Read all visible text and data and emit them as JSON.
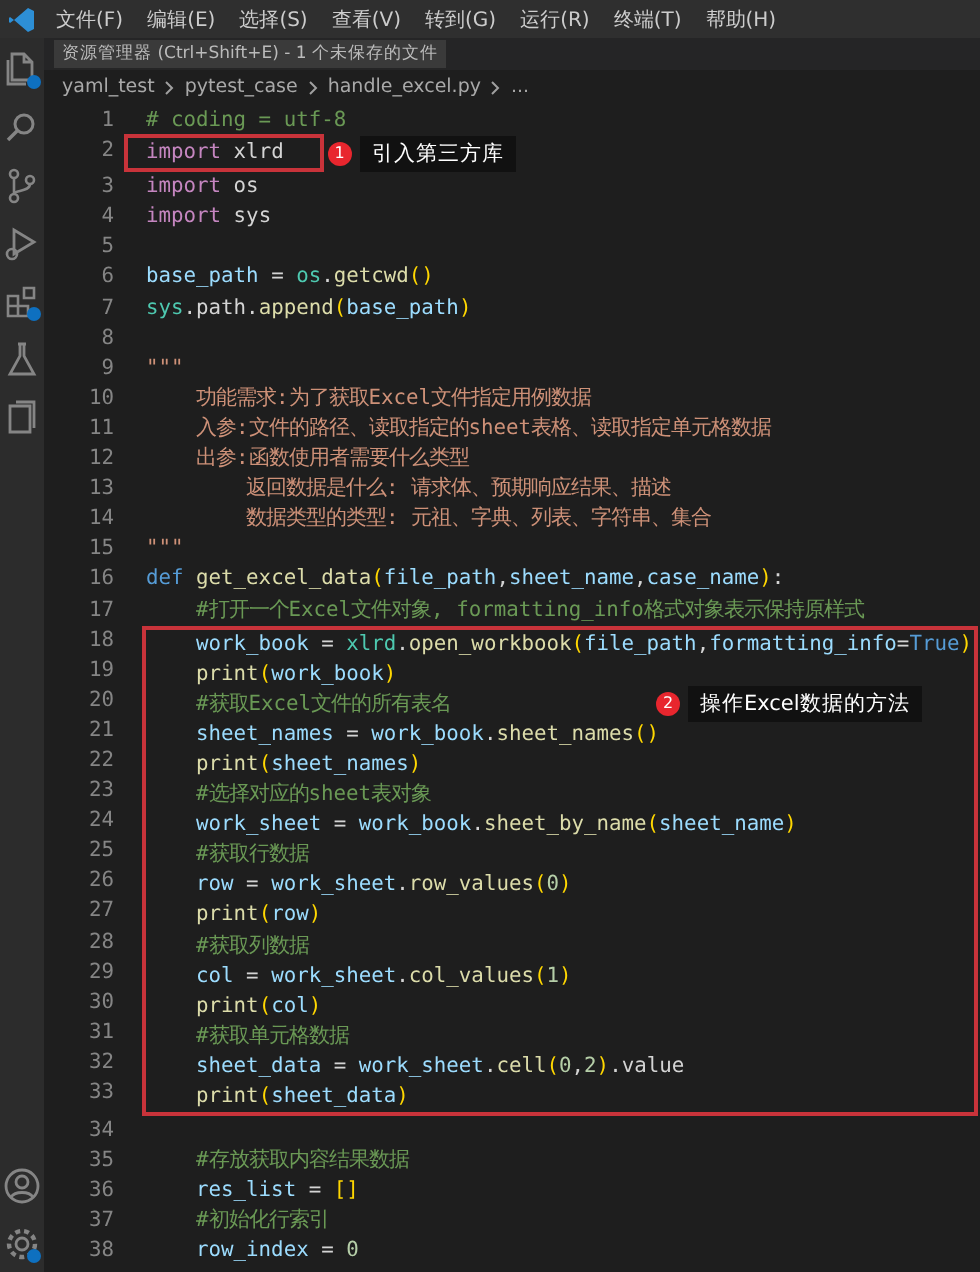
{
  "menu": [
    "文件(F)",
    "编辑(E)",
    "选择(S)",
    "查看(V)",
    "转到(G)",
    "运行(R)",
    "终端(T)",
    "帮助(H)"
  ],
  "tooltip": "资源管理器 (Ctrl+Shift+E) - 1 个未保存的文件",
  "breadcrumb": [
    "yaml_test",
    "pytest_case",
    "handle_excel.py",
    "..."
  ],
  "activity_bar": [
    {
      "kind": "files",
      "badge": true
    },
    {
      "kind": "search",
      "badge": false
    },
    {
      "kind": "source-control",
      "badge": false
    },
    {
      "kind": "run",
      "badge": false
    },
    {
      "kind": "extensions",
      "badge": true
    },
    {
      "kind": "testing",
      "badge": false
    },
    {
      "kind": "docs",
      "badge": false
    }
  ],
  "activity_bottom": [
    {
      "kind": "account",
      "badge": false
    },
    {
      "kind": "settings",
      "badge": true
    }
  ],
  "blocks": [
    {
      "kind": "plain",
      "lines": [
        {
          "number": "1",
          "tokens": [
            {
              "text": "# coding = utf-8",
              "kind": "cmt"
            }
          ]
        }
      ]
    },
    {
      "kind": "tight",
      "callout": {
        "number": "1",
        "label": "引入第三方库"
      },
      "lines": [
        {
          "number": "2",
          "tokens": [
            {
              "text": "import",
              "kind": "kw"
            },
            {
              "text": " xlrd",
              "kind": "p"
            }
          ]
        }
      ]
    },
    {
      "kind": "plain",
      "lines": [
        {
          "number": "3",
          "tokens": [
            {
              "text": "import",
              "kind": "kw"
            },
            {
              "text": " os",
              "kind": "p"
            }
          ]
        },
        {
          "number": "4",
          "tokens": [
            {
              "text": "import",
              "kind": "kw"
            },
            {
              "text": " sys",
              "kind": "p"
            }
          ]
        },
        {
          "number": "5"
        },
        {
          "number": "6",
          "tokens": [
            {
              "text": "base_path",
              "kind": "var"
            },
            {
              "text": " = ",
              "kind": "p"
            },
            {
              "text": "os",
              "kind": "mod"
            },
            {
              "text": ".",
              "kind": "p"
            },
            {
              "text": "getcwd",
              "kind": "fn"
            },
            {
              "text": "()",
              "kind": "br"
            }
          ]
        },
        {
          "number": "7",
          "tokens": [
            {
              "text": "sys",
              "kind": "mod"
            },
            {
              "text": ".path.",
              "kind": "p"
            },
            {
              "text": "append",
              "kind": "fn"
            },
            {
              "text": "(",
              "kind": "br"
            },
            {
              "text": "base_path",
              "kind": "var"
            },
            {
              "text": ")",
              "kind": "br"
            }
          ]
        },
        {
          "number": "8"
        },
        {
          "number": "9",
          "tokens": [
            {
              "text": "\"\"\"",
              "kind": "str"
            }
          ]
        },
        {
          "number": "10",
          "tokens": [
            {
              "text": "    功能需求:为了获取Excel文件指定用例数据",
              "kind": "str"
            }
          ]
        },
        {
          "number": "11",
          "tokens": [
            {
              "text": "    入参:文件的路径、读取指定的sheet表格、读取指定单元格数据",
              "kind": "str"
            }
          ]
        },
        {
          "number": "12",
          "tokens": [
            {
              "text": "    出参:函数使用者需要什么类型",
              "kind": "str"
            }
          ]
        },
        {
          "number": "13",
          "tokens": [
            {
              "text": "        返回数据是什么: 请求体、预期响应结果、描述",
              "kind": "str"
            }
          ]
        },
        {
          "number": "14",
          "tokens": [
            {
              "text": "        数据类型的类型: 元祖、字典、列表、字符串、集合",
              "kind": "str"
            }
          ]
        },
        {
          "number": "15",
          "tokens": [
            {
              "text": "\"\"\"",
              "kind": "str"
            }
          ]
        },
        {
          "number": "16",
          "tokens": [
            {
              "text": "def ",
              "kind": "def"
            },
            {
              "text": "get_excel_data",
              "kind": "fn"
            },
            {
              "text": "(",
              "kind": "br"
            },
            {
              "text": "file_path",
              "kind": "var"
            },
            {
              "text": ",",
              "kind": "p"
            },
            {
              "text": "sheet_name",
              "kind": "var"
            },
            {
              "text": ",",
              "kind": "p"
            },
            {
              "text": "case_name",
              "kind": "var"
            },
            {
              "text": ")",
              "kind": "br"
            },
            {
              "text": ":",
              "kind": "p"
            }
          ]
        },
        {
          "number": "17",
          "tokens": [
            {
              "text": "    #打开一个Excel文件对象, formatting_info格式对象表示保持原样式",
              "kind": "cmt"
            }
          ]
        }
      ]
    },
    {
      "kind": "wide",
      "callout": {
        "number": "2",
        "label": "操作Excel数据的方法"
      },
      "lines": [
        {
          "number": "18",
          "tokens": [
            {
              "text": "    work_book",
              "kind": "var"
            },
            {
              "text": " = ",
              "kind": "p"
            },
            {
              "text": "xlrd",
              "kind": "mod"
            },
            {
              "text": ".",
              "kind": "p"
            },
            {
              "text": "open_workbook",
              "kind": "fn"
            },
            {
              "text": "(",
              "kind": "br"
            },
            {
              "text": "file_path",
              "kind": "var"
            },
            {
              "text": ",",
              "kind": "p"
            },
            {
              "text": "formatting_info",
              "kind": "var"
            },
            {
              "text": "=",
              "kind": "p"
            },
            {
              "text": "True",
              "kind": "def"
            },
            {
              "text": ")",
              "kind": "br"
            }
          ]
        },
        {
          "number": "19",
          "tokens": [
            {
              "text": "    print",
              "kind": "fn"
            },
            {
              "text": "(",
              "kind": "br"
            },
            {
              "text": "work_book",
              "kind": "var"
            },
            {
              "text": ")",
              "kind": "br"
            }
          ]
        },
        {
          "number": "20",
          "tokens": [
            {
              "text": "    #获取Excel文件的所有表名",
              "kind": "cmt"
            }
          ]
        },
        {
          "number": "21",
          "tokens": [
            {
              "text": "    sheet_names",
              "kind": "var"
            },
            {
              "text": " = ",
              "kind": "p"
            },
            {
              "text": "work_book",
              "kind": "var"
            },
            {
              "text": ".",
              "kind": "p"
            },
            {
              "text": "sheet_names",
              "kind": "fn"
            },
            {
              "text": "()",
              "kind": "br"
            }
          ]
        },
        {
          "number": "22",
          "tokens": [
            {
              "text": "    print",
              "kind": "fn"
            },
            {
              "text": "(",
              "kind": "br"
            },
            {
              "text": "sheet_names",
              "kind": "var"
            },
            {
              "text": ")",
              "kind": "br"
            }
          ]
        },
        {
          "number": "23",
          "tokens": [
            {
              "text": "    #选择对应的sheet表对象",
              "kind": "cmt"
            }
          ]
        },
        {
          "number": "24",
          "tokens": [
            {
              "text": "    work_sheet",
              "kind": "var"
            },
            {
              "text": " = ",
              "kind": "p"
            },
            {
              "text": "work_book",
              "kind": "var"
            },
            {
              "text": ".",
              "kind": "p"
            },
            {
              "text": "sheet_by_name",
              "kind": "fn"
            },
            {
              "text": "(",
              "kind": "br"
            },
            {
              "text": "sheet_name",
              "kind": "var"
            },
            {
              "text": ")",
              "kind": "br"
            }
          ]
        },
        {
          "number": "25",
          "tokens": [
            {
              "text": "    #获取行数据",
              "kind": "cmt"
            }
          ]
        },
        {
          "number": "26",
          "tokens": [
            {
              "text": "    row",
              "kind": "var"
            },
            {
              "text": " = ",
              "kind": "p"
            },
            {
              "text": "work_sheet",
              "kind": "var"
            },
            {
              "text": ".",
              "kind": "p"
            },
            {
              "text": "row_values",
              "kind": "fn"
            },
            {
              "text": "(",
              "kind": "br"
            },
            {
              "text": "0",
              "kind": "num"
            },
            {
              "text": ")",
              "kind": "br"
            }
          ]
        },
        {
          "number": "27",
          "tokens": [
            {
              "text": "    print",
              "kind": "fn"
            },
            {
              "text": "(",
              "kind": "br"
            },
            {
              "text": "row",
              "kind": "var"
            },
            {
              "text": ")",
              "kind": "br"
            }
          ]
        },
        {
          "number": "28",
          "tokens": [
            {
              "text": "    #获取列数据",
              "kind": "cmt"
            }
          ]
        },
        {
          "number": "29",
          "tokens": [
            {
              "text": "    col",
              "kind": "var"
            },
            {
              "text": " = ",
              "kind": "p"
            },
            {
              "text": "work_sheet",
              "kind": "var"
            },
            {
              "text": ".",
              "kind": "p"
            },
            {
              "text": "col_values",
              "kind": "fn"
            },
            {
              "text": "(",
              "kind": "br"
            },
            {
              "text": "1",
              "kind": "num"
            },
            {
              "text": ")",
              "kind": "br"
            }
          ]
        },
        {
          "number": "30",
          "tokens": [
            {
              "text": "    print",
              "kind": "fn"
            },
            {
              "text": "(",
              "kind": "br"
            },
            {
              "text": "col",
              "kind": "var"
            },
            {
              "text": ")",
              "kind": "br"
            }
          ]
        },
        {
          "number": "31",
          "tokens": [
            {
              "text": "    #获取单元格数据",
              "kind": "cmt"
            }
          ]
        },
        {
          "number": "32",
          "tokens": [
            {
              "text": "    sheet_data",
              "kind": "var"
            },
            {
              "text": " = ",
              "kind": "p"
            },
            {
              "text": "work_sheet",
              "kind": "var"
            },
            {
              "text": ".",
              "kind": "p"
            },
            {
              "text": "cell",
              "kind": "fn"
            },
            {
              "text": "(",
              "kind": "br"
            },
            {
              "text": "0",
              "kind": "num"
            },
            {
              "text": ",",
              "kind": "p"
            },
            {
              "text": "2",
              "kind": "num"
            },
            {
              "text": ")",
              "kind": "br"
            },
            {
              "text": ".value",
              "kind": "p"
            }
          ]
        },
        {
          "number": "33",
          "tokens": [
            {
              "text": "    print",
              "kind": "fn"
            },
            {
              "text": "(",
              "kind": "br"
            },
            {
              "text": "sheet_data",
              "kind": "var"
            },
            {
              "text": ")",
              "kind": "br"
            }
          ]
        }
      ]
    },
    {
      "kind": "plain",
      "lines": [
        {
          "number": "34"
        },
        {
          "number": "35",
          "tokens": [
            {
              "text": "    #存放获取内容结果数据",
              "kind": "cmt"
            }
          ]
        },
        {
          "number": "36",
          "tokens": [
            {
              "text": "    res_list",
              "kind": "var"
            },
            {
              "text": " = ",
              "kind": "p"
            },
            {
              "text": "[]",
              "kind": "br"
            }
          ]
        },
        {
          "number": "37",
          "tokens": [
            {
              "text": "    #初始化行索引",
              "kind": "cmt"
            }
          ]
        },
        {
          "number": "38",
          "tokens": [
            {
              "text": "    row_index",
              "kind": "var"
            },
            {
              "text": " = ",
              "kind": "p"
            },
            {
              "text": "0",
              "kind": "num"
            }
          ]
        }
      ]
    }
  ]
}
